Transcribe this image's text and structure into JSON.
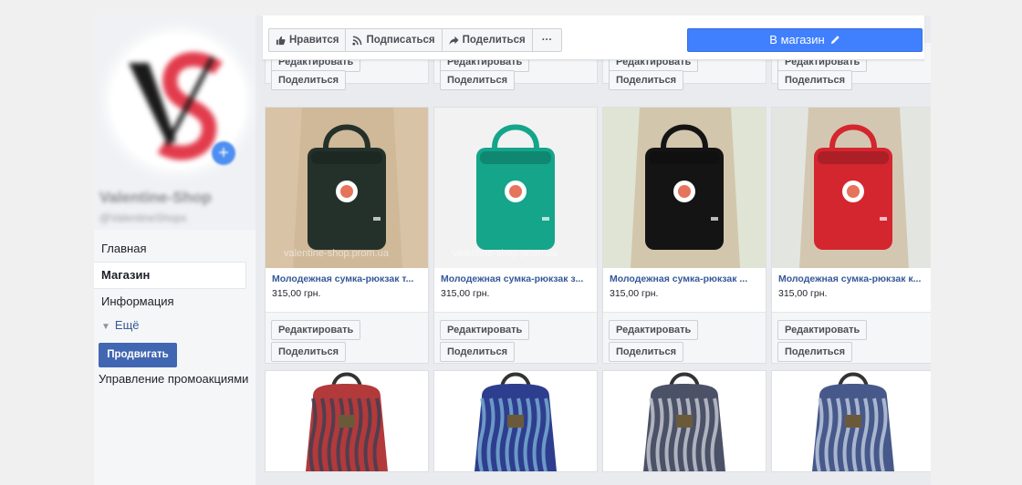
{
  "colors": {
    "accent": "#4080ff",
    "link": "#365899",
    "promote": "#4267b2"
  },
  "sidebar": {
    "page_name": "Valentine-Shop",
    "page_handle": "@ValentineShopx",
    "nav": [
      {
        "label": "Главная"
      },
      {
        "label": "Магазин"
      },
      {
        "label": "Информация"
      }
    ],
    "more_label": "Ещё",
    "promote_label": "Продвигать",
    "manage_label": "Управление промоакциями"
  },
  "actions": {
    "like": {
      "label": "Нравится",
      "icon": "thumbs-up-icon"
    },
    "follow": {
      "label": "Подписаться",
      "icon": "rss-icon"
    },
    "share": {
      "label": "Поделиться",
      "icon": "share-arrow-icon"
    },
    "more": {
      "label": "···",
      "icon": "ellipsis-icon"
    },
    "shop_button": {
      "label": "В магазин",
      "icon": "pencil-icon"
    }
  },
  "buttons": {
    "edit": "Редактировать",
    "share": "Поделиться"
  },
  "products_row1": [
    {
      "title": "Молодежная сумка-рюкзак т...",
      "price": "315,00 грн.",
      "bag_color": "#24312b",
      "bg": "#d8c3a6",
      "watermark": "valentine-shop.prom.ua"
    },
    {
      "title": "Молодежная сумка-рюкзак з...",
      "price": "315,00 грн.",
      "bag_color": "#14a58a",
      "bg": "#f2f2f2",
      "watermark": "valentine-shop.prom.ua"
    },
    {
      "title": "Молодежная сумка-рюкзак ...",
      "price": "315,00 грн.",
      "bag_color": "#141414",
      "bg": "#dfe4d4",
      "watermark": ""
    },
    {
      "title": "Молодежная сумка-рюкзак к...",
      "price": "315,00 грн.",
      "bag_color": "#d4262f",
      "bg": "#e3e6e0",
      "watermark": ""
    }
  ],
  "products_row2": [
    {
      "bag_color": "#b23a3a",
      "pattern": "#3b3f55"
    },
    {
      "bag_color": "#2e3e8e",
      "pattern": "#7ab0d6"
    },
    {
      "bag_color": "#4b5166",
      "pattern": "#c9ccd6"
    },
    {
      "bag_color": "#46598a",
      "pattern": "#c3cde0"
    }
  ]
}
